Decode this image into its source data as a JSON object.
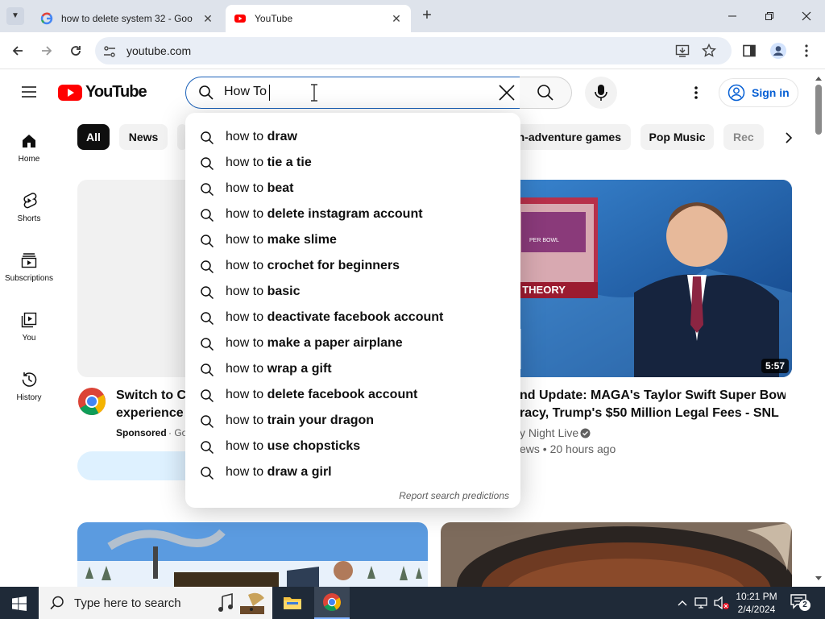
{
  "browser": {
    "tabs": [
      {
        "title": "how to delete system 32 - Goo",
        "active": false
      },
      {
        "title": "YouTube",
        "active": true
      }
    ],
    "url": "youtube.com"
  },
  "youtube": {
    "logo_text": "YouTube",
    "search_value": "How To",
    "signin_label": "Sign in",
    "sidebar": [
      {
        "label": "Home",
        "icon": "home-icon"
      },
      {
        "label": "Shorts",
        "icon": "shorts-icon"
      },
      {
        "label": "Subscriptions",
        "icon": "subscriptions-icon"
      },
      {
        "label": "You",
        "icon": "you-icon"
      },
      {
        "label": "History",
        "icon": "history-icon"
      }
    ],
    "chips": [
      "All",
      "News",
      "on-adventure games",
      "Pop Music",
      "Rec"
    ],
    "suggestions": [
      {
        "prefix": "how to ",
        "rest": "draw"
      },
      {
        "prefix": "how to ",
        "rest": "tie a tie"
      },
      {
        "prefix": "how to ",
        "rest": "beat"
      },
      {
        "prefix": "how to ",
        "rest": "delete instagram account"
      },
      {
        "prefix": "how to ",
        "rest": "make slime"
      },
      {
        "prefix": "how to ",
        "rest": "crochet for beginners"
      },
      {
        "prefix": "how to ",
        "rest": "basic"
      },
      {
        "prefix": "how to ",
        "rest": "deactivate facebook account"
      },
      {
        "prefix": "how to ",
        "rest": "make a paper airplane"
      },
      {
        "prefix": "how to ",
        "rest": "wrap a gift"
      },
      {
        "prefix": "how to ",
        "rest": "delete facebook account"
      },
      {
        "prefix": "how to ",
        "rest": "train your dragon"
      },
      {
        "prefix": "how to ",
        "rest": "use chopsticks"
      },
      {
        "prefix": "how to ",
        "rest": "draw a girl"
      }
    ],
    "report_label": "Report search predictions",
    "sponsored": {
      "title_line1": "Switch to Ch",
      "title_line2": "experience v",
      "sponsored_label": "Sponsored",
      "advertiser": "· Go"
    },
    "video2": {
      "duration": "5:57",
      "title_line1": "nd Update: MAGA's Taylor Swift Super Bowl",
      "title_line2": "racy, Trump's $50 Million Legal Fees - SNL",
      "channel": "y Night Live",
      "meta": "ews • 20 hours ago",
      "thumb_text": "SPIRACY THEORY",
      "thumb_text2": "PER BOWL"
    }
  },
  "taskbar": {
    "search_placeholder": "Type here to search",
    "time": "10:21 PM",
    "date": "2/4/2024",
    "notifications": "2"
  },
  "colors": {
    "accent": "#065fd4",
    "yt_red": "#ff0000",
    "tabbar": "#dee3eb",
    "taskbar": "#1f2a38"
  }
}
